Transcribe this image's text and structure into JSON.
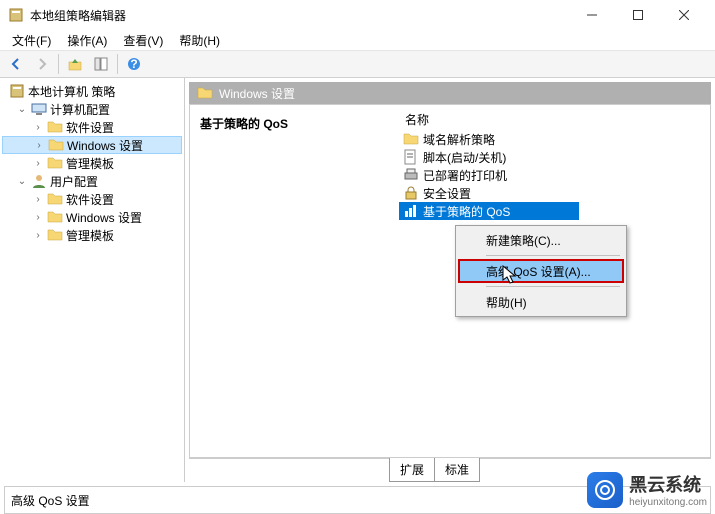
{
  "window": {
    "title": "本地组策略编辑器"
  },
  "menus": {
    "file": "文件(F)",
    "action": "操作(A)",
    "view": "查看(V)",
    "help": "帮助(H)"
  },
  "tree": {
    "root": "本地计算机 策略",
    "computer": {
      "label": "计算机配置",
      "software": "软件设置",
      "windows": "Windows 设置",
      "templates": "管理模板"
    },
    "user": {
      "label": "用户配置",
      "software": "软件设置",
      "windows": "Windows 设置",
      "templates": "管理模板"
    }
  },
  "right": {
    "header": "Windows 设置",
    "detail_title": "基于策略的 QoS",
    "col_name": "名称",
    "items": [
      "域名解析策略",
      "脚本(启动/关机)",
      "已部署的打印机",
      "安全设置",
      "基于策略的 QoS"
    ]
  },
  "tabs": {
    "extended": "扩展",
    "standard": "标准"
  },
  "context_menu": {
    "new_policy": "新建策略(C)...",
    "advanced": "高级 QoS 设置(A)...",
    "help": "帮助(H)"
  },
  "status": "高级 QoS 设置",
  "watermark": {
    "brand": "黑云系统",
    "url": "heiyunxitong.com"
  }
}
